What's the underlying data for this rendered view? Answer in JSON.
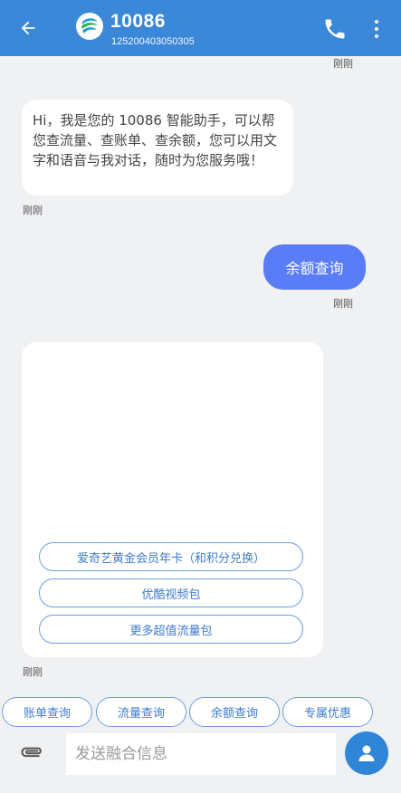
{
  "header": {
    "title": "10086",
    "subtitle": "125200403050305",
    "back_icon": "arrow-left-icon",
    "logo_icon": "china-mobile-logo",
    "call_icon": "phone-icon",
    "more_icon": "more-vertical-icon",
    "bar_color": "#3b87d8"
  },
  "messages": {
    "top_timestamp": "刚刚",
    "greeting": {
      "text": "Hi，我是您的 10086 智能助手，可以帮您查流量、查账单、查余额，您可以用文字和语音与我对话，随时为您服务哦！",
      "timestamp": "刚刚"
    },
    "user_query": {
      "text": "余额查询",
      "timestamp": "刚刚",
      "bubble_color": "#5a7cf7"
    },
    "card": {
      "buttons": [
        "爱奇艺黄金会员年卡（和积分兑换）",
        "优酷视频包",
        "更多超值流量包"
      ],
      "timestamp": "刚刚"
    }
  },
  "quick_replies": [
    "账单查询",
    "流量查询",
    "余额查询",
    "专属优惠"
  ],
  "composer": {
    "attach_icon": "paperclip-icon",
    "placeholder": "发送融合信息",
    "profile_icon": "user-icon"
  }
}
